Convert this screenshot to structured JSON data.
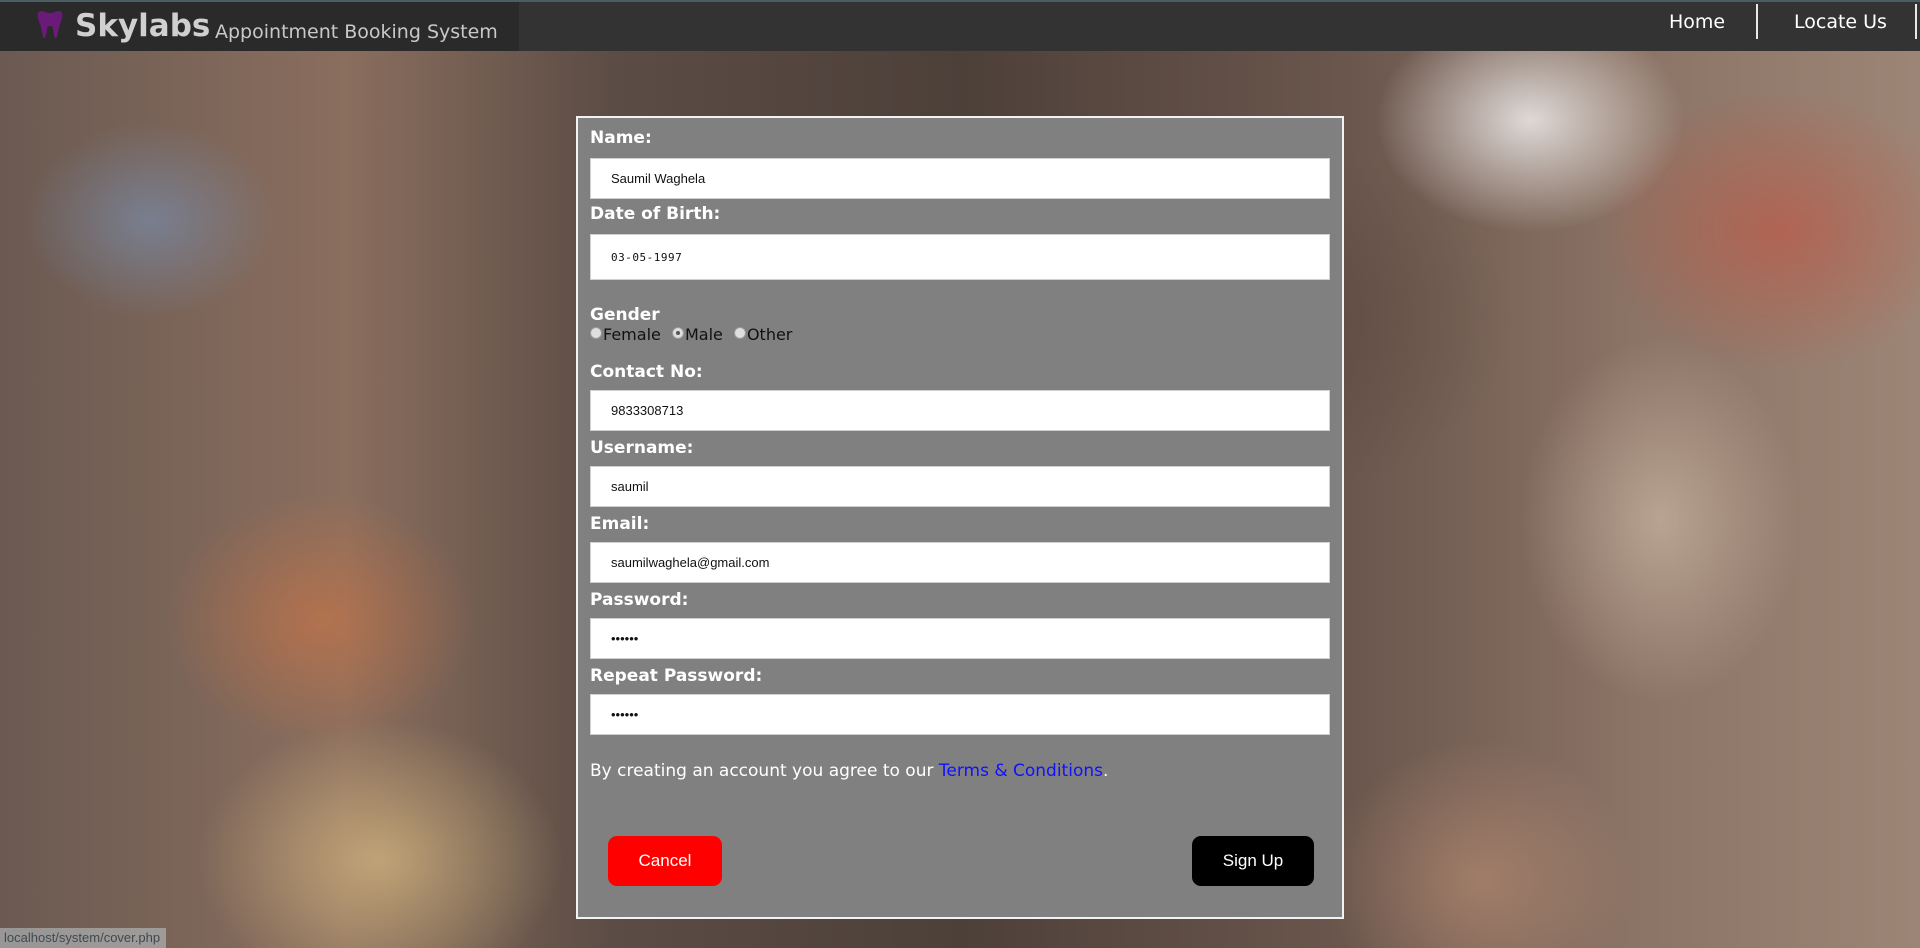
{
  "navbar": {
    "brand_name": "Skylabs",
    "brand_subtitle": "Appointment Booking System",
    "logo_icon": "tooth-icon",
    "logo_color": "#6a1b7a",
    "links": {
      "home": "Home",
      "locate": "Locate Us"
    }
  },
  "form": {
    "name": {
      "label": "Name:",
      "value": "Saumil Waghela"
    },
    "dob": {
      "label": "Date of Birth:",
      "value": "03-05-1997"
    },
    "gender": {
      "label": "Gender",
      "options": [
        "Female",
        "Male",
        "Other"
      ],
      "selected": "Male"
    },
    "contact": {
      "label": "Contact No:",
      "value": "9833308713"
    },
    "username": {
      "label": "Username:",
      "value": "saumil"
    },
    "email": {
      "label": "Email:",
      "value": "saumilwaghela@gmail.com"
    },
    "password": {
      "label": "Password:",
      "value": "••••••"
    },
    "repeat_password": {
      "label": "Repeat Password:",
      "value": "••••••"
    },
    "terms": {
      "prefix": "By creating an account you agree to our ",
      "link": "Terms & Conditions",
      "suffix": "."
    },
    "buttons": {
      "cancel": "Cancel",
      "signup": "Sign Up"
    },
    "colors": {
      "cancel": "#ff0000",
      "signup": "#000000",
      "link": "#1010ff"
    }
  },
  "status_bar": {
    "url": "localhost/system/cover.php"
  }
}
